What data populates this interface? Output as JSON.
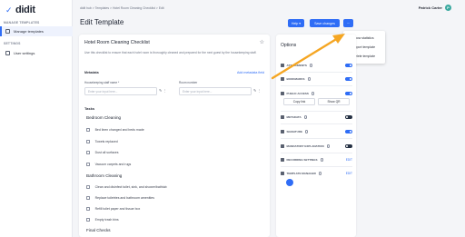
{
  "sidebar": {
    "logo_text": "didit",
    "sections": [
      {
        "label": "MANAGE TEMPLATES",
        "items": [
          {
            "label": "Manage templates",
            "active": true
          }
        ]
      },
      {
        "label": "SETTINGS",
        "items": [
          {
            "label": "User settings",
            "active": false
          }
        ]
      }
    ]
  },
  "header": {
    "breadcrumbs": "didit hub  >  Templates  >  Hotel Room Cleaning Checklist  >  Edit",
    "title": "Edit Template",
    "user_name": "Patrick Carter",
    "user_initial": "P",
    "help_label": "Help ▾",
    "save_label": "Save changes",
    "more_label": "···"
  },
  "dropdown": {
    "items": [
      "Show statistics",
      "Export template",
      "Delete template"
    ]
  },
  "template": {
    "title": "Hotel Room Cleaning Checklist",
    "description": "Use this checklist to ensure that each hotel room is thoroughly cleaned and prepared for the next guest by the housekeeping staff.",
    "metadata_label": "Metadata",
    "add_metadata_label": "Add metadata field",
    "fields": [
      {
        "label": "Housekeeping staff name *",
        "placeholder": "Enter your input here..."
      },
      {
        "label": "Room number",
        "placeholder": "Enter your input here..."
      }
    ],
    "tasks_label": "Tasks",
    "groups": [
      {
        "title": "Bedroom Cleaning",
        "tasks": [
          "Bed linen changed and beds made",
          "Towels replaced",
          "Dust all surfaces",
          "Vacuum carpets and rugs"
        ]
      },
      {
        "title": "Bathroom Cleaning",
        "tasks": [
          "Clean and disinfect toilet, sink, and shower/bathtub",
          "Replace toiletries and bathroom amenities",
          "Refill toilet paper and tissue box",
          "Empty trash bins"
        ]
      },
      {
        "title": "Final Checks",
        "tasks": []
      }
    ]
  },
  "options": {
    "title": "Options",
    "rows": [
      {
        "label": "ATTACHMENTS",
        "control": "toggle",
        "state": "on"
      },
      {
        "label": "BOOKMARKS",
        "control": "toggle",
        "state": "on"
      },
      {
        "label": "PUBLIC ACCESS",
        "control": "toggle",
        "state": "on"
      },
      {
        "label": "METADATA",
        "control": "toggle",
        "state": "off"
      },
      {
        "label": "SIGNATURE",
        "control": "toggle",
        "state": "on"
      },
      {
        "label": "MANDATORY EXPLANATION",
        "control": "toggle",
        "state": "off"
      },
      {
        "label": "RECURRING SETTINGS",
        "control": "edit",
        "edit_label": "EDIT"
      },
      {
        "label": "TEMPLATE MANAGER",
        "control": "edit",
        "edit_label": "EDIT"
      }
    ],
    "copy_link_label": "Copy link",
    "show_qr_label": "Show QR"
  },
  "colors": {
    "accent": "#2f6df6",
    "arrow": "#f5a623",
    "toggle_off": "#263244"
  }
}
